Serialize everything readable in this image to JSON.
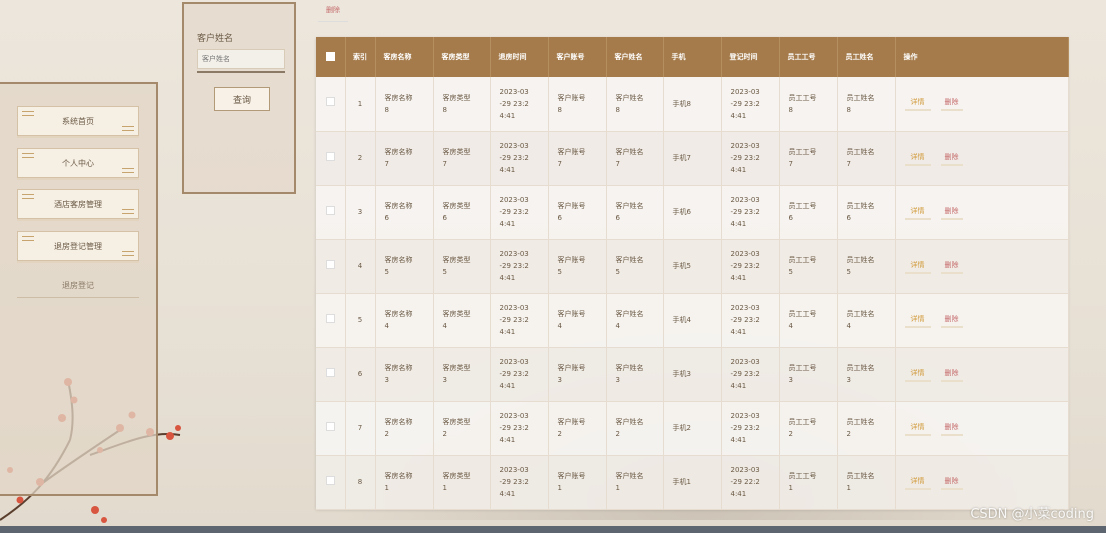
{
  "sidebar": {
    "items": [
      {
        "label": "系统首页"
      },
      {
        "label": "个人中心"
      },
      {
        "label": "酒店客房管理"
      },
      {
        "label": "退房登记管理"
      }
    ],
    "sub_item": "退房登记"
  },
  "search": {
    "label": "客户姓名",
    "placeholder": "客户姓名",
    "button": "查询"
  },
  "toolbar": {
    "delete_label": "删除"
  },
  "table": {
    "headers": [
      "索引",
      "客房名称",
      "客房类型",
      "退房时间",
      "客户账号",
      "客户姓名",
      "手机",
      "登记时间",
      "员工工号",
      "员工姓名",
      "操作"
    ],
    "rows": [
      {
        "index": "1",
        "room_name": "客房名称\n8",
        "room_type": "客房类型\n8",
        "checkout_time": "2023-03\n-29 23:2\n4:41",
        "account": "客户账号\n8",
        "name": "客户姓名\n8",
        "phone": "手机8",
        "reg_time": "2023-03\n-29 23:2\n4:41",
        "staff_no": "员工工号\n8",
        "staff_name": "员工姓名\n8"
      },
      {
        "index": "2",
        "room_name": "客房名称\n7",
        "room_type": "客房类型\n7",
        "checkout_time": "2023-03\n-29 23:2\n4:41",
        "account": "客户账号\n7",
        "name": "客户姓名\n7",
        "phone": "手机7",
        "reg_time": "2023-03\n-29 23:2\n4:41",
        "staff_no": "员工工号\n7",
        "staff_name": "员工姓名\n7"
      },
      {
        "index": "3",
        "room_name": "客房名称\n6",
        "room_type": "客房类型\n6",
        "checkout_time": "2023-03\n-29 23:2\n4:41",
        "account": "客户账号\n6",
        "name": "客户姓名\n6",
        "phone": "手机6",
        "reg_time": "2023-03\n-29 23:2\n4:41",
        "staff_no": "员工工号\n6",
        "staff_name": "员工姓名\n6"
      },
      {
        "index": "4",
        "room_name": "客房名称\n5",
        "room_type": "客房类型\n5",
        "checkout_time": "2023-03\n-29 23:2\n4:41",
        "account": "客户账号\n5",
        "name": "客户姓名\n5",
        "phone": "手机5",
        "reg_time": "2023-03\n-29 23:2\n4:41",
        "staff_no": "员工工号\n5",
        "staff_name": "员工姓名\n5"
      },
      {
        "index": "5",
        "room_name": "客房名称\n4",
        "room_type": "客房类型\n4",
        "checkout_time": "2023-03\n-29 23:2\n4:41",
        "account": "客户账号\n4",
        "name": "客户姓名\n4",
        "phone": "手机4",
        "reg_time": "2023-03\n-29 23:2\n4:41",
        "staff_no": "员工工号\n4",
        "staff_name": "员工姓名\n4"
      },
      {
        "index": "6",
        "room_name": "客房名称\n3",
        "room_type": "客房类型\n3",
        "checkout_time": "2023-03\n-29 23:2\n4:41",
        "account": "客户账号\n3",
        "name": "客户姓名\n3",
        "phone": "手机3",
        "reg_time": "2023-03\n-29 23:2\n4:41",
        "staff_no": "员工工号\n3",
        "staff_name": "员工姓名\n3"
      },
      {
        "index": "7",
        "room_name": "客房名称\n2",
        "room_type": "客房类型\n2",
        "checkout_time": "2023-03\n-29 23:2\n4:41",
        "account": "客户账号\n2",
        "name": "客户姓名\n2",
        "phone": "手机2",
        "reg_time": "2023-03\n-29 23:2\n4:41",
        "staff_no": "员工工号\n2",
        "staff_name": "员工姓名\n2"
      },
      {
        "index": "8",
        "room_name": "客房名称\n1",
        "room_type": "客房类型\n1",
        "checkout_time": "2023-03\n-29 23:2\n4:41",
        "account": "客户账号\n1",
        "name": "客户姓名\n1",
        "phone": "手机1",
        "reg_time": "2023-03\n-29 22:2\n4:41",
        "staff_no": "员工工号\n1",
        "staff_name": "员工姓名\n1"
      }
    ],
    "actions": {
      "detail": "详情",
      "delete": "删除"
    }
  },
  "watermark": "CSDN @小菜coding",
  "colors": {
    "header_bg": "#a57b4b",
    "accent_gold": "#d19a3a",
    "danger": "#c56a6a"
  }
}
